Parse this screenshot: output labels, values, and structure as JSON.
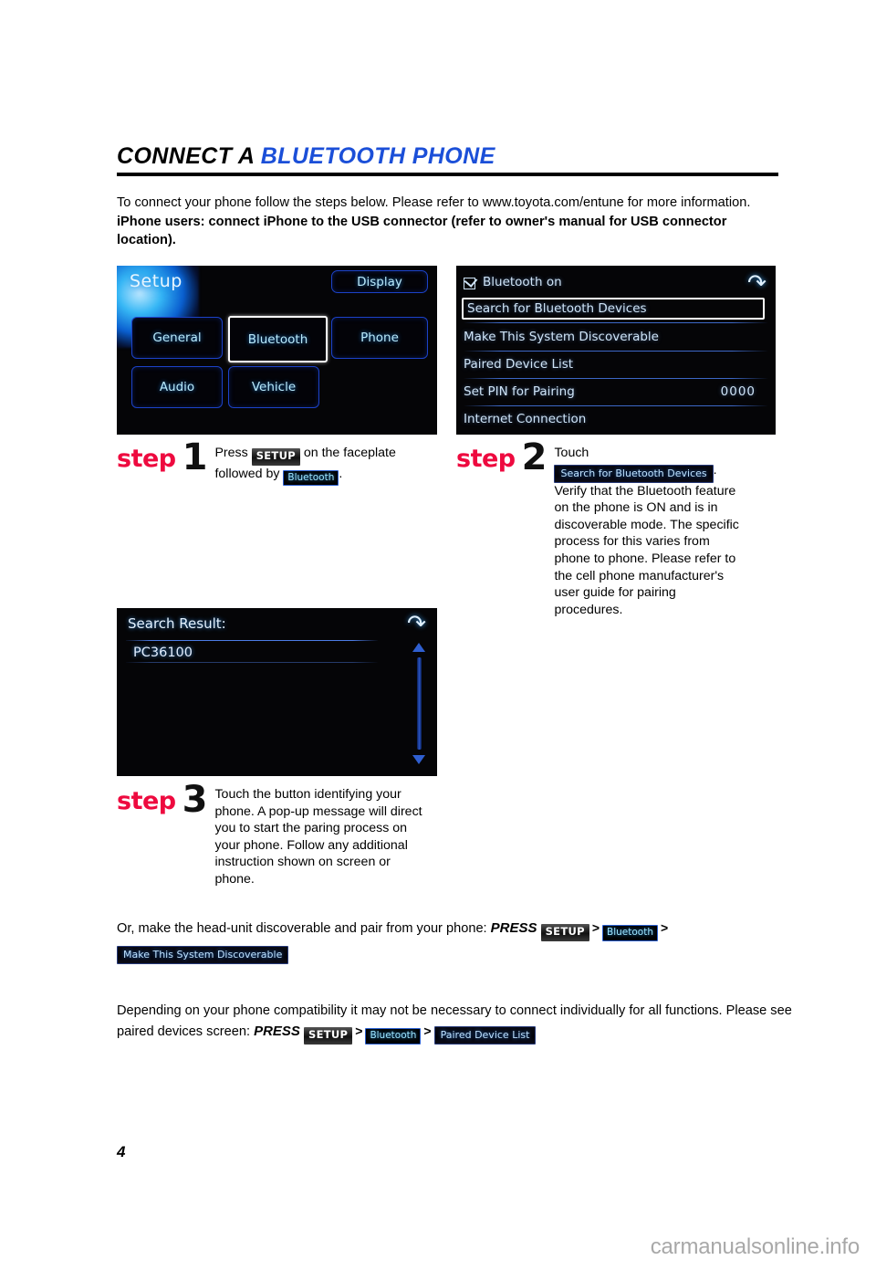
{
  "document": {
    "title_black": "CONNECT A ",
    "title_blue": "BLUETOOTH PHONE",
    "page_number": "4",
    "watermark": "carmanualsonline.info"
  },
  "intro": {
    "line1": "To connect your phone follow the steps below. Please refer to www.toyota.com/entune for more information.",
    "line2": "iPhone users: connect iPhone to the USB connector (refer to owner's manual for USB connector location)."
  },
  "screens": {
    "setup": {
      "heading": "Setup",
      "tiles": [
        {
          "label": "Display",
          "selected": false
        },
        {
          "label": "General",
          "selected": false
        },
        {
          "label": "Bluetooth",
          "selected": true
        },
        {
          "label": "Phone",
          "selected": false
        },
        {
          "label": "Audio",
          "selected": false
        },
        {
          "label": "Vehicle",
          "selected": false
        }
      ]
    },
    "bluetooth_menu": {
      "toggle_label": "Bluetooth on",
      "back_icon": "back-arrow-icon",
      "rows": [
        {
          "label": "Search for Bluetooth Devices",
          "value": "",
          "highlighted": true
        },
        {
          "label": "Make This System Discoverable",
          "value": "",
          "highlighted": false
        },
        {
          "label": "Paired Device List",
          "value": "",
          "highlighted": false
        },
        {
          "label": "Set PIN for Pairing",
          "value": "0000",
          "highlighted": false
        },
        {
          "label": "Internet Connection",
          "value": "",
          "highlighted": false
        }
      ]
    },
    "search_result": {
      "heading": "Search Result:",
      "back_icon": "back-arrow-icon",
      "devices": [
        "PC36100"
      ]
    }
  },
  "steps": [
    {
      "word": "step",
      "number": "1",
      "text_parts": [
        {
          "type": "text",
          "value": "Press "
        },
        {
          "type": "badge_setup",
          "value": "SETUP"
        },
        {
          "type": "text",
          "value": " on the faceplate followed by "
        },
        {
          "type": "badge_bt",
          "value": "Bluetooth"
        },
        {
          "type": "text",
          "value": "."
        }
      ]
    },
    {
      "word": "step",
      "number": "2",
      "text_parts": [
        {
          "type": "text",
          "value": "Touch "
        },
        {
          "type": "badge_wide",
          "value": "Search for Bluetooth Devices"
        },
        {
          "type": "text",
          "value": ". Verify that the Bluetooth feature on the phone is ON and is in discoverable mode.  The specific process for this varies from phone to phone. Please refer to the cell phone manufacturer's user guide for pairing procedures."
        }
      ]
    },
    {
      "word": "step",
      "number": "3",
      "text_parts": [
        {
          "type": "text",
          "value": "Touch the button identifying your phone. A pop-up message will direct you to start the paring process on your phone. Follow any additional instruction shown on screen or phone."
        }
      ]
    }
  ],
  "notes": [
    {
      "lead": "Or, make the head-unit discoverable and pair from your phone: ",
      "press": "PRESS",
      "chain": [
        {
          "type": "badge_setup",
          "value": "SETUP"
        },
        {
          "type": "sep",
          "value": ">"
        },
        {
          "type": "badge_bt",
          "value": "Bluetooth"
        },
        {
          "type": "sep",
          "value": ">"
        },
        {
          "type": "badge_wide",
          "value": "Make This System Discoverable"
        }
      ]
    },
    {
      "lead": "Depending on your phone compatibility it may not be necessary to connect individually for all functions. Please see paired devices screen:  ",
      "press": "PRESS",
      "chain": [
        {
          "type": "badge_setup",
          "value": "SETUP"
        },
        {
          "type": "sep",
          "value": ">"
        },
        {
          "type": "badge_bt",
          "value": "Bluetooth"
        },
        {
          "type": "sep",
          "value": ">"
        },
        {
          "type": "badge_wide",
          "value": "Paired Device List"
        }
      ]
    }
  ],
  "colors": {
    "accent_blue": "#1b4fd8",
    "step_red": "#ee0a3f",
    "screen_cyan": "#b9e9fb",
    "screen_border_blue": "#1c42c8"
  }
}
